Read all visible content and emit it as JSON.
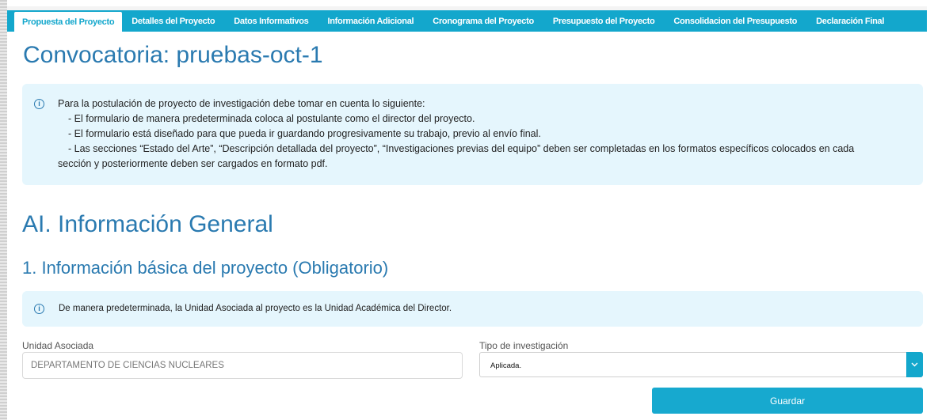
{
  "tabs": [
    {
      "label": "Propuesta del Proyecto",
      "active": true
    },
    {
      "label": "Detalles del Proyecto",
      "active": false
    },
    {
      "label": "Datos Informativos",
      "active": false
    },
    {
      "label": "Información Adicional",
      "active": false
    },
    {
      "label": "Cronograma del Proyecto",
      "active": false
    },
    {
      "label": "Presupuesto del Proyecto",
      "active": false
    },
    {
      "label": "Consolidacion del Presupuesto",
      "active": false
    },
    {
      "label": "Declaración Final",
      "active": false
    }
  ],
  "page_title": "Convocatoria: pruebas-oct-1",
  "notice": {
    "icon": "info-icon",
    "intro": "Para la postulación de proyecto de investigación debe tomar en cuenta lo siguiente:",
    "line1": "- El formulario de manera predeterminada coloca al postulante como el director del proyecto.",
    "line2": "- El formulario está diseñado para que pueda ir guardando progresivamente su trabajo, previo al envío final.",
    "line3a": "- Las secciones “Estado del Arte”, “Descripción detallada del proyecto”, “Investigaciones previas del equipo” deben ser completadas en los formatos específicos colocados en cada",
    "line3b": "sección y posteriormente deben ser cargados en formato pdf."
  },
  "section_title": "AI. Información General",
  "subsection_title": "1. Información básica del proyecto (Obligatorio)",
  "info_note": {
    "icon": "info-icon",
    "text": "De manera predeterminada, la Unidad Asociada al proyecto es la Unidad Académica del Director."
  },
  "form": {
    "unidad_label": "Unidad Asociada",
    "unidad_value": "DEPARTAMENTO DE CIENCIAS NUCLEARES",
    "tipo_label": "Tipo de investigación",
    "tipo_value": "Aplicada.",
    "save_label": "Guardar"
  },
  "colors": {
    "accent": "#13a7cc",
    "title": "#2a7ab0",
    "notice_bg": "#e5f6fd"
  }
}
